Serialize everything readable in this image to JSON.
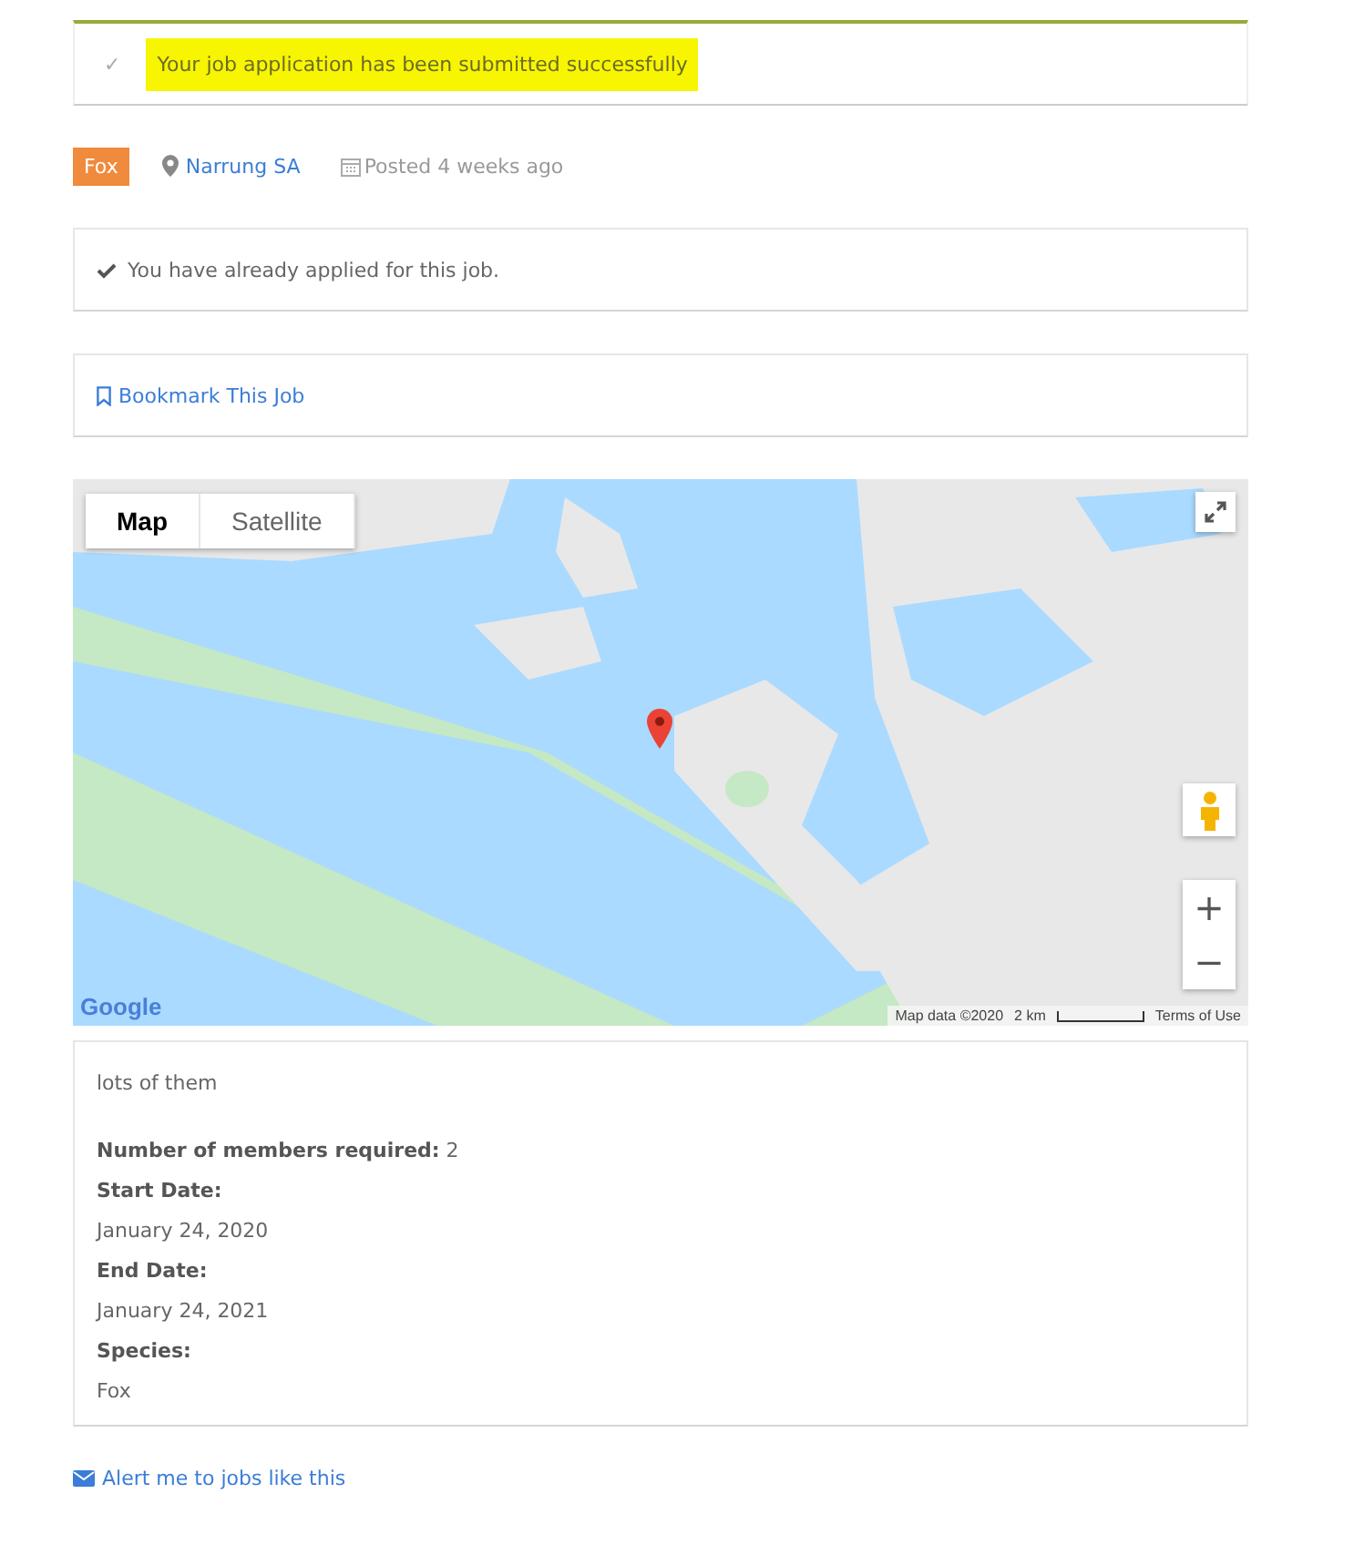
{
  "alert": {
    "icon": "✓",
    "message": "Your job application has been submitted successfully",
    "highlighted": true
  },
  "meta": {
    "tag": "Fox",
    "location": "Narrung SA",
    "posted": "Posted 4 weeks ago"
  },
  "applied_notice": "You have already applied for this job.",
  "bookmark": "Bookmark This Job",
  "map": {
    "kind": "picture",
    "types": [
      {
        "label": "Map",
        "selected": true
      },
      {
        "label": "Satellite",
        "selected": false
      }
    ],
    "zoom_in": "+",
    "zoom_out": "−",
    "logo": "Google",
    "attribution": "Map data ©2020",
    "scale": "2 km",
    "terms": "Terms of Use"
  },
  "description": "lots of them",
  "details": [
    {
      "label": "Number of members required:",
      "value": "2",
      "kind": "inline"
    },
    {
      "label": "Start Date:",
      "value": "January 24, 2020",
      "kind": "stacked"
    },
    {
      "label": "End Date:",
      "value": "January 24, 2021",
      "kind": "stacked"
    },
    {
      "label": "Species:",
      "value": "Fox",
      "kind": "stacked"
    }
  ],
  "alert_link": "Alert me to jobs like this"
}
